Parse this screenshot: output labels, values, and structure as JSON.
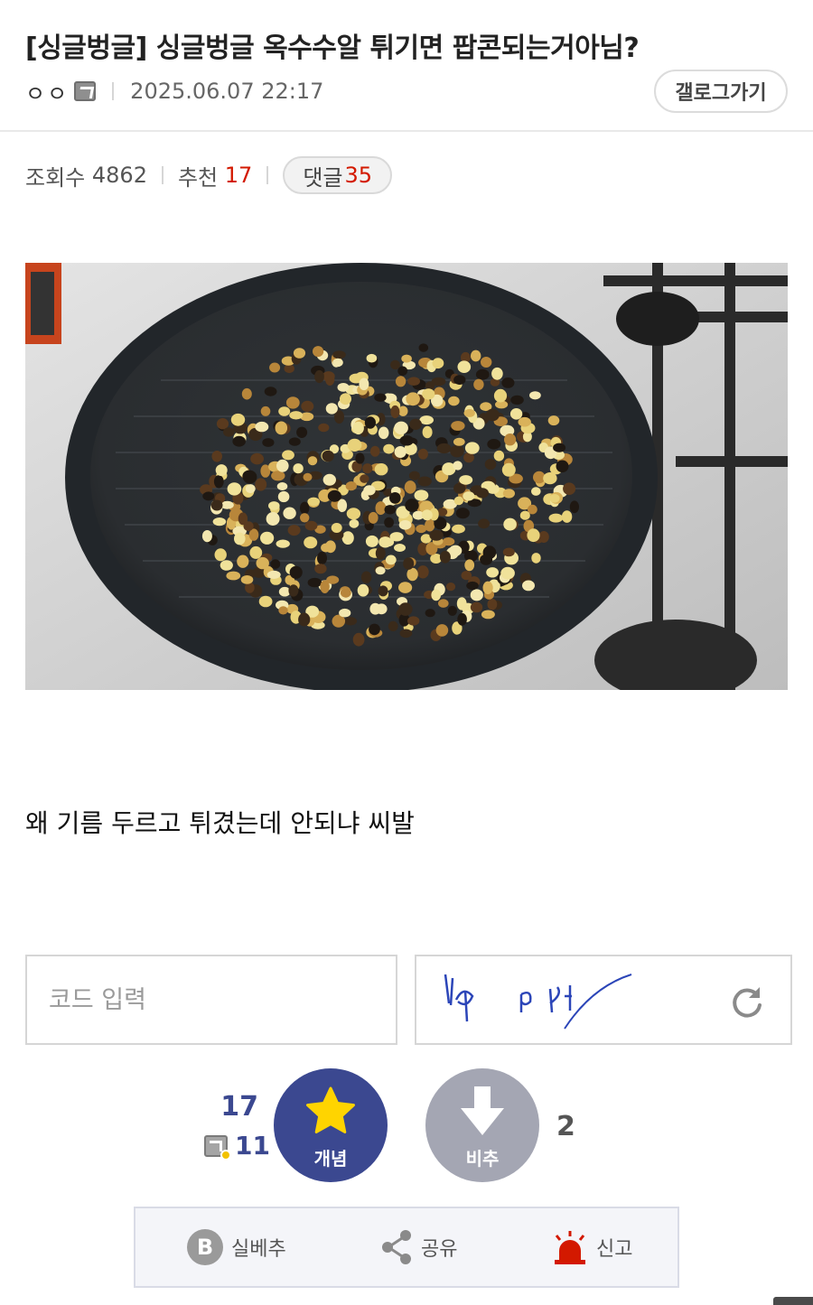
{
  "post": {
    "title": "[싱글벙글] 싱글벙글 옥수수알 튀기면 팝콘되는거아님?",
    "author": "ㅇㅇ",
    "date": "2025.06.07 22:17",
    "gallog_button": "갤로그가기",
    "views_label": "조회수",
    "views": "4862",
    "recommend_label": "추천",
    "recommend": "17",
    "comments_label": "댓글",
    "comments": "35",
    "body": "왜 기름 두르고 튀겼는데 안되냐 씨발"
  },
  "captcha": {
    "placeholder": "코드 입력"
  },
  "vote": {
    "up_count": "17",
    "fixed_up_count": "11",
    "up_label": "개념",
    "down_label": "비추",
    "down_count": "2"
  },
  "actions": {
    "best": "실베추",
    "share": "공유",
    "report": "신고"
  },
  "colors": {
    "accent": "#3b4890",
    "red": "#d31900",
    "down": "#a4a6b3"
  }
}
